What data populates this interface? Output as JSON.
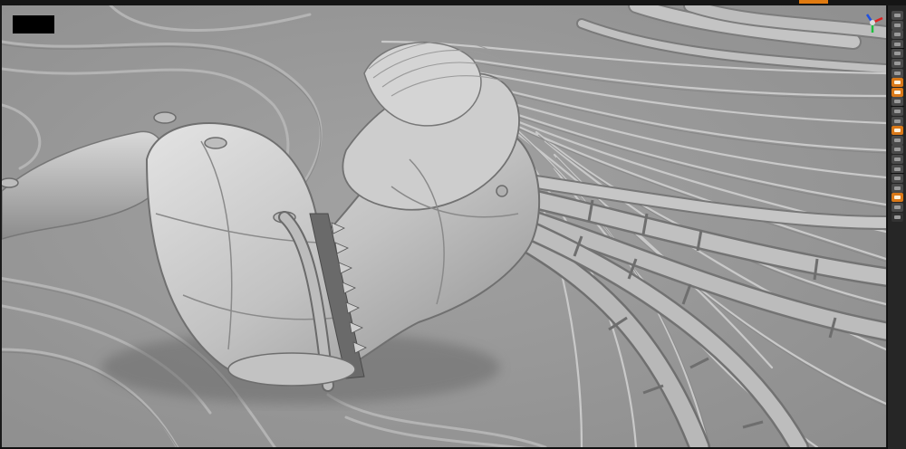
{
  "window": {
    "title": ""
  },
  "viewport": {
    "background": "#9c9c9c",
    "model_color": "#c4c4c4",
    "model_shadow": "#8a8a8a",
    "model_highlight": "#e6e6e6",
    "cable_color": "#b8b8b8",
    "cable_dark": "#7a7a7a",
    "scene": "sculpt-figure-with-cables"
  },
  "gizmo": {
    "axes": [
      {
        "axis": "x",
        "color": "#e02020"
      },
      {
        "axis": "y",
        "color": "#20c040"
      },
      {
        "axis": "z",
        "color": "#2050e0"
      }
    ]
  },
  "right_shelf": {
    "tools": [
      {
        "id": "persp",
        "icon": "perspective-icon",
        "state": "normal"
      },
      {
        "id": "floor",
        "icon": "floor-grid-icon",
        "state": "normal"
      },
      {
        "id": "local",
        "icon": "local-symmetry-icon",
        "state": "normal"
      },
      {
        "id": "xyz",
        "icon": "xyz-axis-icon",
        "state": "normal"
      },
      {
        "id": "frame",
        "icon": "frame-icon",
        "state": "normal"
      },
      {
        "id": "move",
        "icon": "move-icon",
        "state": "normal"
      },
      {
        "id": "zoom",
        "icon": "zoom-icon",
        "state": "normal"
      },
      {
        "id": "rotate",
        "icon": "rotate-icon",
        "state": "active"
      },
      {
        "id": "polyf",
        "icon": "polyframe-icon",
        "state": "active"
      },
      {
        "id": "transp",
        "icon": "transparency-icon",
        "state": "normal"
      },
      {
        "id": "ghost",
        "icon": "ghost-icon",
        "state": "normal"
      },
      {
        "id": "solo",
        "icon": "solo-icon",
        "state": "normal"
      },
      {
        "id": "xpose",
        "icon": "xpose-icon",
        "state": "active"
      },
      {
        "id": "spot",
        "icon": "spotlight-icon",
        "state": "normal"
      },
      {
        "id": "lsym",
        "icon": "symmetry-icon",
        "state": "normal"
      },
      {
        "id": "draw",
        "icon": "draw-pointer-icon",
        "state": "normal"
      },
      {
        "id": "scale",
        "icon": "scale-icon",
        "state": "normal"
      },
      {
        "id": "edit",
        "icon": "edit-icon",
        "state": "normal"
      },
      {
        "id": "sub1",
        "icon": "subtool-icon",
        "state": "normal"
      },
      {
        "id": "sub2",
        "icon": "subtool-icon",
        "state": "active"
      },
      {
        "id": "sub3",
        "icon": "subtool-icon",
        "state": "normal"
      },
      {
        "id": "sub4",
        "icon": "subtool-icon",
        "state": "dark"
      }
    ]
  },
  "indicator": {
    "color": "#000000"
  },
  "accent": "#e07a10"
}
